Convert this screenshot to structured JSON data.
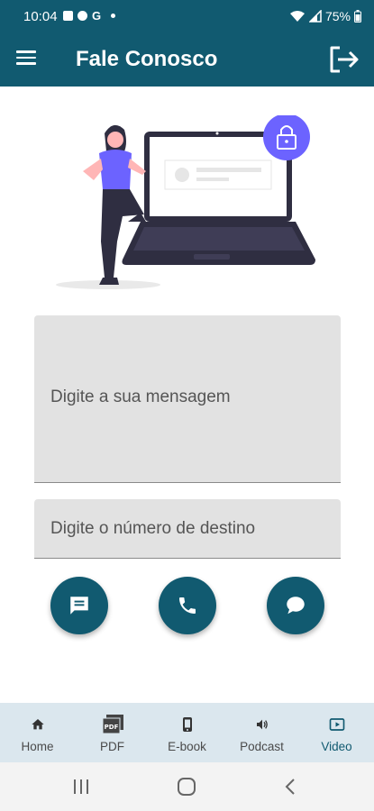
{
  "status_bar": {
    "time": "10:04",
    "left_icons": [
      "image-icon",
      "settings-icon",
      "google-icon"
    ],
    "google_letter": "G",
    "battery": "75%"
  },
  "app_bar": {
    "title": "Fale Conosco",
    "menu_icon": "menu-icon",
    "logout_icon": "logout-icon"
  },
  "form": {
    "message_placeholder": "Digite a sua mensagem",
    "number_placeholder": "Digite o número de destino"
  },
  "actions": [
    {
      "name": "sms",
      "icon": "sms-icon"
    },
    {
      "name": "call",
      "icon": "phone-icon"
    },
    {
      "name": "chat",
      "icon": "chat-icon"
    }
  ],
  "bottom_nav": {
    "items": [
      {
        "label": "Home",
        "icon": "home-icon",
        "active": false
      },
      {
        "label": "PDF",
        "icon": "pdf-icon",
        "active": false
      },
      {
        "label": "E-book",
        "icon": "phone-book-icon",
        "active": false
      },
      {
        "label": "Podcast",
        "icon": "speaker-icon",
        "active": false
      },
      {
        "label": "Video",
        "icon": "video-icon",
        "active": true
      }
    ]
  },
  "colors": {
    "primary": "#115a70",
    "nav_bg": "#dbe7ee",
    "field_bg": "#e2e2e2",
    "accent_lock": "#6c63ff"
  }
}
